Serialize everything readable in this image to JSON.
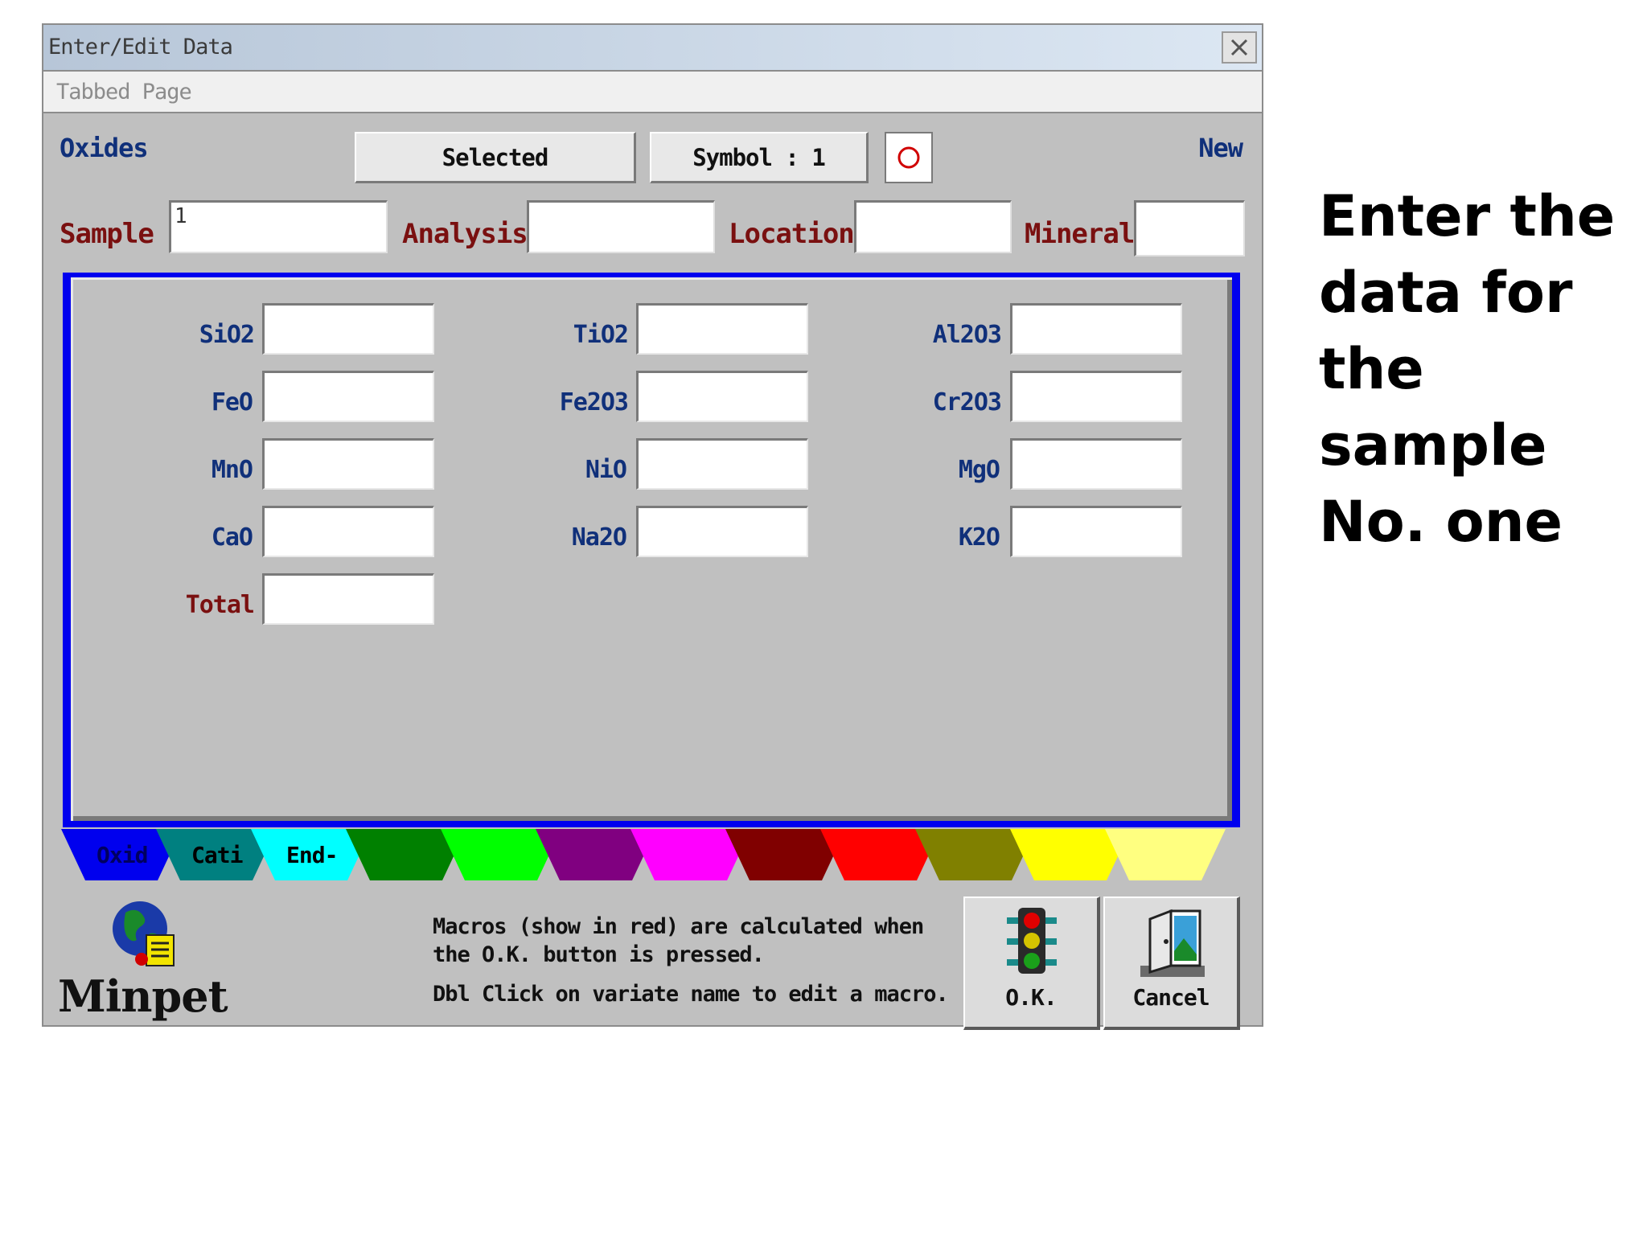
{
  "window": {
    "title": "Enter/Edit Data",
    "tab_label": "Tabbed Page"
  },
  "toolbar": {
    "oxides_label": "Oxides",
    "selected_label": "Selected",
    "symbol_label": "Symbol : 1",
    "new_label": "New"
  },
  "header_fields": {
    "sample_label": "Sample",
    "sample_value": "1",
    "analysis_label": "Analysis",
    "analysis_value": "",
    "location_label": "Location",
    "location_value": "",
    "mineral_label": "Mineral",
    "mineral_value": ""
  },
  "oxides": {
    "col1": [
      "SiO2",
      "FeO",
      "MnO",
      "CaO"
    ],
    "col2": [
      "TiO2",
      "Fe2O3",
      "NiO",
      "Na2O"
    ],
    "col3": [
      "Al2O3",
      "Cr2O3",
      "MgO",
      "K2O"
    ],
    "total_label": "Total"
  },
  "color_tabs": [
    {
      "label": "Oxid",
      "color": "#0000ee",
      "text_color": "#000060"
    },
    {
      "label": "Cati",
      "color": "#008080",
      "text_color": "#000000"
    },
    {
      "label": "End-",
      "color": "#00ffff",
      "text_color": "#000000"
    },
    {
      "label": "",
      "color": "#008000"
    },
    {
      "label": "",
      "color": "#00ff00"
    },
    {
      "label": "",
      "color": "#800080"
    },
    {
      "label": "",
      "color": "#ff00ff"
    },
    {
      "label": "",
      "color": "#800000"
    },
    {
      "label": "",
      "color": "#ff0000"
    },
    {
      "label": "",
      "color": "#808000"
    },
    {
      "label": "",
      "color": "#ffff00"
    },
    {
      "label": "",
      "color": "#ffff80"
    }
  ],
  "footer": {
    "logo_text": "Minpet",
    "info_line1": "Macros (show in red) are calculated when",
    "info_line2": "the O.K. button is pressed.",
    "info_line3": "Dbl Click on variate name to edit a macro.",
    "ok_label": "O.K.",
    "cancel_label": "Cancel"
  },
  "annotation": {
    "text": "Enter the data for the sample No. one"
  },
  "colors": {
    "label_blue": "#10307a",
    "label_red": "#7a1010",
    "panel_border": "#0000ee",
    "window_bg": "#c0c0c0"
  }
}
